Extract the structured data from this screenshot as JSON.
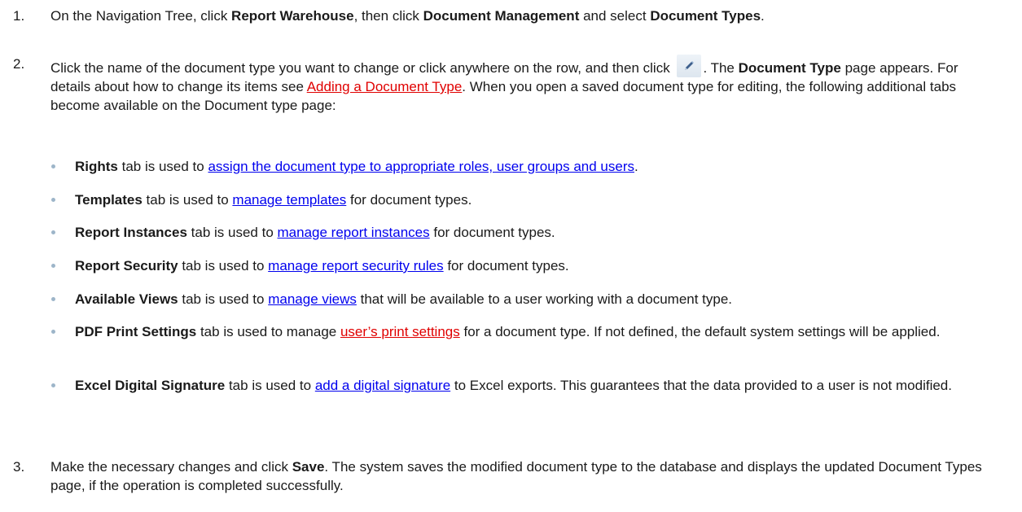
{
  "steps": [
    {
      "num": "1.",
      "t1": "On the Navigation Tree, click ",
      "b1": "Report Warehouse",
      "t2": ", then click ",
      "b2": "Document Management",
      "t3": " and select ",
      "b3": "Document Types",
      "t4": "."
    },
    {
      "num": "2.",
      "t1": "Click the name of the document type you want to change or click anywhere on the row, and then click ",
      "t2": ". The ",
      "b1": "Document Type",
      "t3": " page appears. For details about how to change its items see ",
      "link": "Adding a Document Type",
      "t4": ". When you open a saved document type for editing, the following additional tabs become available on the Document type page:"
    },
    {
      "num": "3.",
      "t1": "Make the necessary changes and click ",
      "b1": "Save",
      "t2": ". The system saves the modified document type to the database and displays the updated Document Types page, if the operation is completed successfully."
    }
  ],
  "bullets": [
    {
      "bold": "Rights",
      "pre": " tab is used to ",
      "link": "assign the document type to appropriate roles, user groups and users",
      "post": "."
    },
    {
      "bold": "Templates",
      "pre": " tab is used to ",
      "link": "manage templates",
      "post": " for document types."
    },
    {
      "bold": "Report Instances",
      "pre": " tab is used to ",
      "link": "manage report instances",
      "post": " for document types."
    },
    {
      "bold": "Report Security",
      "pre": " tab is used to ",
      "link": "manage report security rules",
      "post": " for document types."
    },
    {
      "bold": "Available Views",
      "pre": " tab is used to ",
      "link": "manage views",
      "post": " that will be available to a user working with a document type."
    },
    {
      "bold": "PDF Print Settings",
      "pre": " tab is used to manage ",
      "link": "user’s print settings",
      "post": " for a document type. If not defined, the default system settings will be applied."
    },
    {
      "bold": "Excel Digital Signature",
      "pre": " tab is used to ",
      "link": "add a digital signature",
      "post": " to Excel exports. This guarantees that the data provided to a user is not modified."
    }
  ],
  "icons": {
    "edit": "pencil-icon"
  },
  "colors": {
    "link_blue": "#0000ee",
    "link_red": "#e00000",
    "bullet": "#9db5c9"
  }
}
